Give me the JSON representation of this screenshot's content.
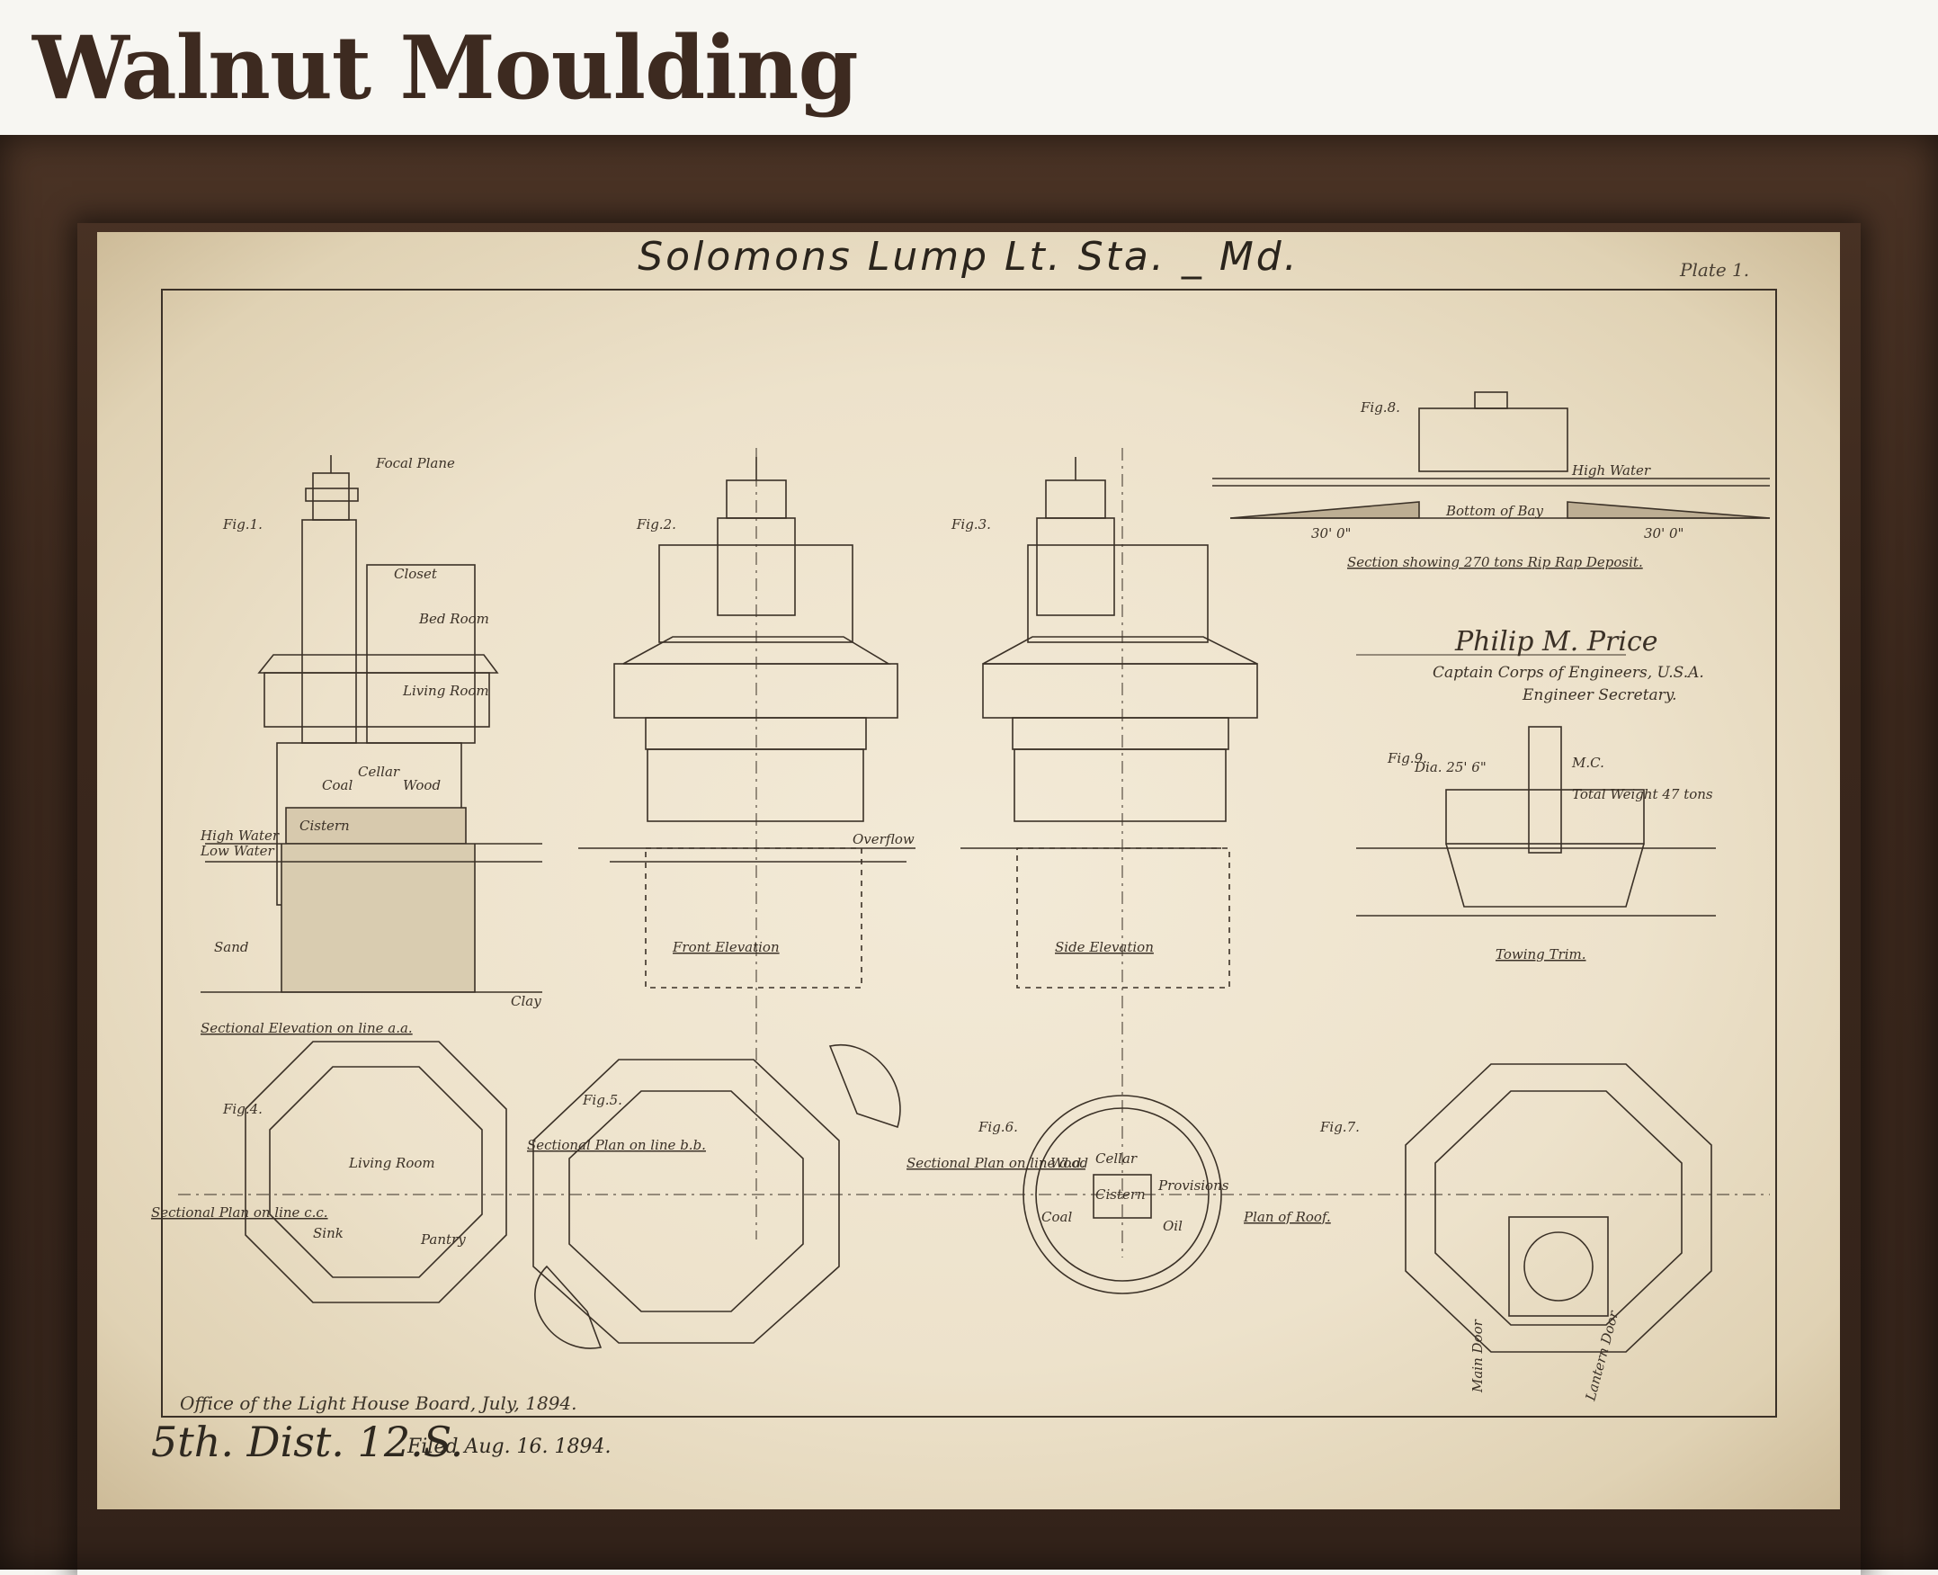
{
  "header": {
    "title": "Walnut Moulding"
  },
  "print": {
    "title": "Solomons Lump Lt. Sta. _ Md.",
    "plate": "Plate 1.",
    "office": "Office of the Light House Board, July, 1894.",
    "district": "5th. Dist. 12.S.",
    "filed": "Filed Aug. 16. 1894.",
    "figures": {
      "fig1": "Fig.1.",
      "fig2": "Fig.2.",
      "fig3": "Fig.3.",
      "fig4": "Fig.4.",
      "fig5": "Fig.5.",
      "fig6": "Fig.6.",
      "fig7": "Fig.7.",
      "fig8": "Fig.8.",
      "fig9": "Fig.9."
    },
    "captions": {
      "sectional_elevation": "Sectional Elevation on line a.a.",
      "front_elevation": "Front Elevation",
      "side_elevation": "Side Elevation",
      "rip_rap": "Section showing 270 tons Rip Rap Deposit.",
      "towing_trim": "Towing Trim.",
      "plan_cc": "Sectional Plan on line c.c.",
      "plan_bb": "Sectional Plan on line b.b.",
      "plan_dd": "Sectional Plan on line d.d.",
      "plan_roof": "Plan of Roof."
    },
    "labels": {
      "focal_plane": "Focal Plane",
      "closet": "Closet",
      "bed_room": "Bed Room",
      "living_room": "Living Room",
      "coal": "Coal",
      "cellar": "Cellar",
      "wood": "Wood",
      "cistern": "Cistern",
      "high_water": "High Water",
      "low_water": "Low Water",
      "sand": "Sand",
      "clay": "Clay",
      "overflow": "Overflow",
      "bottom_of_bay": "Bottom of Bay",
      "dim_30": "30' 0\"",
      "total_weight": "Total Weight 47 tons",
      "dia": "Dia. 25' 6\"",
      "mc": "M.C.",
      "provisions": "Provisions",
      "oil": "Oil",
      "pantry": "Pantry",
      "sink": "Sink",
      "main_door": "Main Door",
      "lantern_door": "Lantern Door"
    },
    "signature": {
      "name": "Philip M. Price",
      "title_line1": "Captain Corps of Engineers, U.S.A.",
      "title_line2": "Engineer Secretary."
    }
  }
}
